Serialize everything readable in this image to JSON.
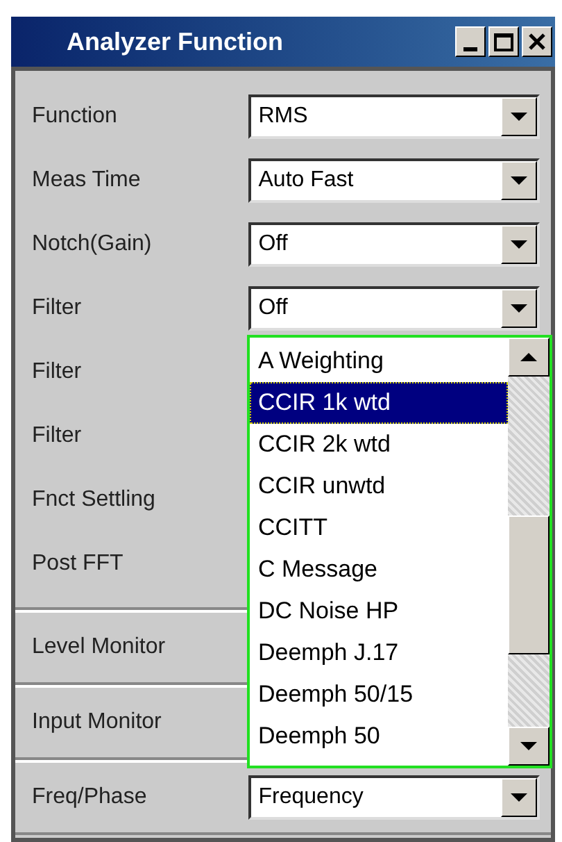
{
  "window": {
    "title": "Analyzer Function"
  },
  "sections": [
    {
      "rows": [
        {
          "label": "Function",
          "value": "RMS"
        },
        {
          "label": "Meas Time",
          "value": "Auto Fast"
        },
        {
          "label": "Notch(Gain)",
          "value": "Off"
        },
        {
          "label": "Filter",
          "value": "Off"
        },
        {
          "label": "Filter"
        },
        {
          "label": "Filter"
        },
        {
          "label": "Fnct Settling"
        },
        {
          "label": "Post FFT"
        }
      ]
    },
    {
      "rows": [
        {
          "label": "Level Monitor"
        }
      ]
    },
    {
      "rows": [
        {
          "label": "Input Monitor"
        }
      ]
    },
    {
      "rows": [
        {
          "label": "Freq/Phase",
          "value": "Frequency"
        }
      ]
    }
  ],
  "popup_list": [
    {
      "label": "A Weighting",
      "selected": false
    },
    {
      "label": "CCIR 1k wtd",
      "selected": true
    },
    {
      "label": "CCIR 2k wtd",
      "selected": false
    },
    {
      "label": "CCIR unwtd",
      "selected": false
    },
    {
      "label": "CCITT",
      "selected": false
    },
    {
      "label": "C Message",
      "selected": false
    },
    {
      "label": "DC Noise HP",
      "selected": false
    },
    {
      "label": "Deemph J.17",
      "selected": false
    },
    {
      "label": "Deemph 50/15",
      "selected": false
    },
    {
      "label": "Deemph 50",
      "selected": false
    }
  ]
}
